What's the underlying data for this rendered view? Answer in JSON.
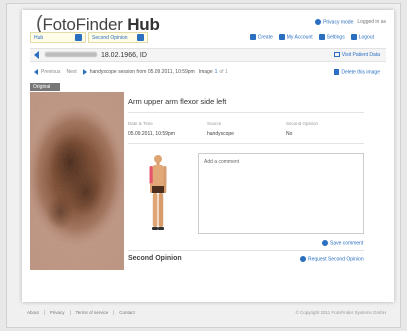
{
  "header": {
    "logo_prefix": "FotoFinder",
    "logo_suffix": "Hub",
    "privacy_mode": "Privacy mode",
    "logged_in": "Logged in as"
  },
  "toolbar": {
    "tab_hub": "Hub",
    "tab_second_opinion": "Second Opinion",
    "create": "Create",
    "my_account": "My Account",
    "settings": "Settings",
    "logout": "Logout"
  },
  "patient": {
    "name_suffix": "18.02.1966, ID",
    "visit_patient_data": "Visit Patient Data"
  },
  "session": {
    "previous": "Previous",
    "next": "Next",
    "text": "handyscope session from 05.09.2011, 10:59pm",
    "image_label": "Image",
    "image_index": "1",
    "image_total": "of 1",
    "delete": "Delete this image"
  },
  "image": {
    "tab": "Original"
  },
  "details": {
    "location": "Arm upper arm flexor side left",
    "date_label": "Date & Time",
    "date_value": "05.09.2011, 10:59pm",
    "source_label": "Source",
    "source_value": "handyscope",
    "second_label": "Second Opinion",
    "second_value": "No"
  },
  "comment": {
    "placeholder": "Add a comment",
    "save": "Save comment"
  },
  "second_opinion": {
    "title": "Second Opinion",
    "request": "Request Second Opinion"
  },
  "footer": {
    "about": "About",
    "privacy": "Privacy",
    "terms": "Terms of service",
    "contact": "Contact",
    "copyright": "© Copyright 2011 FotoFinder Systems GmbH"
  },
  "colors": {
    "accent": "#2a6fc0",
    "tab_field_bg": "#fffde8"
  }
}
